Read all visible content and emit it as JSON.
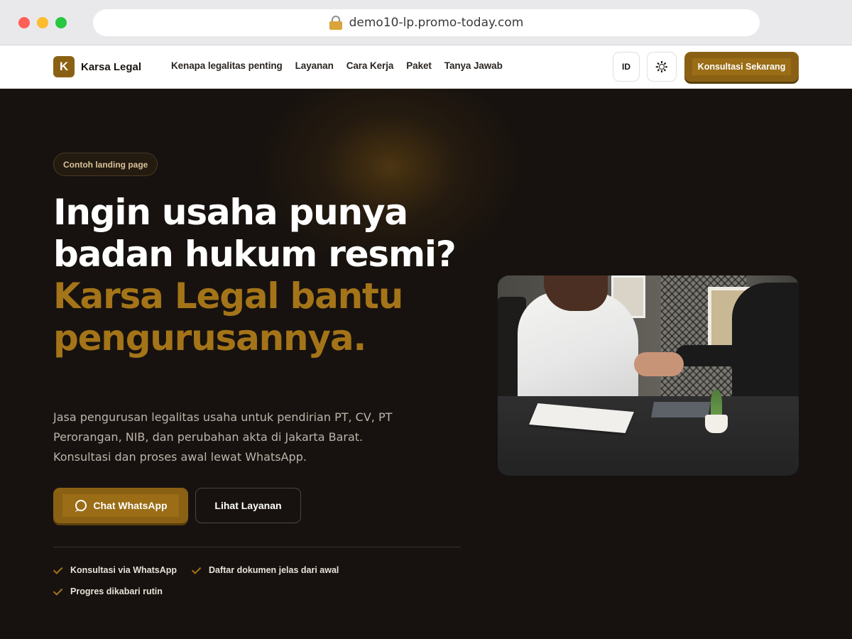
{
  "browser": {
    "url": "demo10-lp.promo-today.com"
  },
  "header": {
    "logo_letter": "K",
    "brand": "Karsa Legal",
    "nav": [
      "Kenapa legalitas penting",
      "Layanan",
      "Cara Kerja",
      "Paket",
      "Tanya Jawab"
    ],
    "lang": "ID",
    "cta": "Konsultasi Sekarang"
  },
  "hero": {
    "badge": "Contoh landing page",
    "headline_plain": "Ingin usaha punya badan hukum resmi?",
    "headline_accent": "Karsa Legal bantu pengurusannya.",
    "lead": "Jasa pengurusan legalitas usaha untuk pendirian PT, CV, PT Perorangan, NIB, dan perubahan akta di Jakarta Barat. Konsultasi dan proses awal lewat WhatsApp.",
    "primary_cta": "Chat WhatsApp",
    "secondary_cta": "Lihat Layanan",
    "checks": [
      "Konsultasi via WhatsApp",
      "Daftar dokumen jelas dari awal",
      "Progres dikabari rutin"
    ]
  },
  "colors": {
    "accent": "#a47418",
    "button": "#8a6114",
    "background": "#17120f"
  }
}
